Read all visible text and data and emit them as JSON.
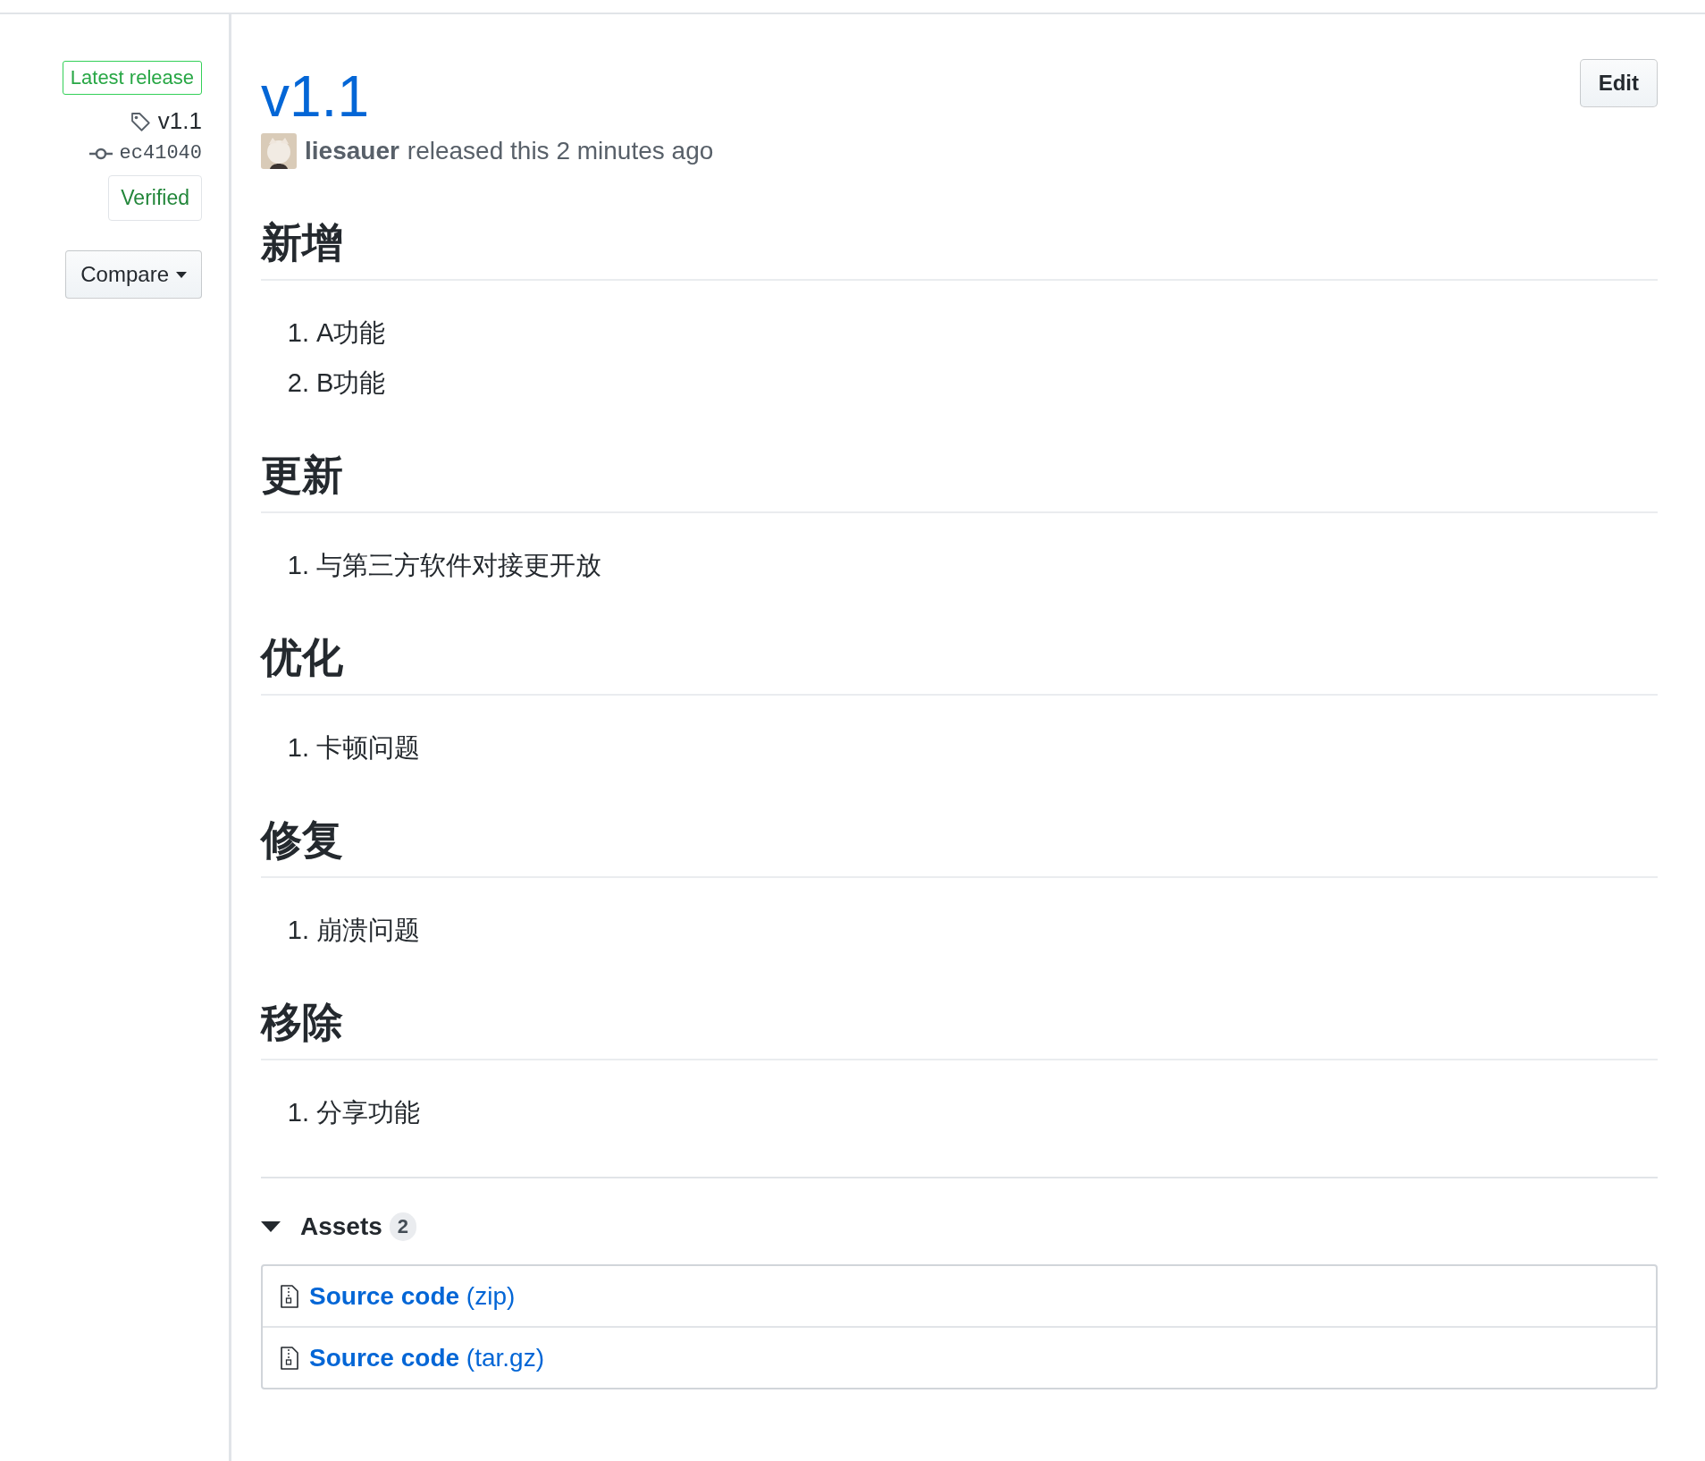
{
  "sidebar": {
    "badge": "Latest release",
    "tag": "v1.1",
    "commit": "ec41040",
    "verified": "Verified",
    "compare_button": "Compare"
  },
  "release": {
    "title": "v1.1",
    "author": "liesauer",
    "byline": "released this 2 minutes ago",
    "edit_button": "Edit"
  },
  "sections": [
    {
      "heading": "新增",
      "items": [
        {
          "number": "1.",
          "text": "A功能"
        },
        {
          "number": "2.",
          "text": "B功能"
        }
      ]
    },
    {
      "heading": "更新",
      "items": [
        {
          "number": "1.",
          "text": "与第三方软件对接更开放"
        }
      ]
    },
    {
      "heading": "优化",
      "items": [
        {
          "number": "1.",
          "text": "卡顿问题"
        }
      ]
    },
    {
      "heading": "修复",
      "items": [
        {
          "number": "1.",
          "text": "崩溃问题"
        }
      ]
    },
    {
      "heading": "移除",
      "items": [
        {
          "number": "1.",
          "text": "分享功能"
        }
      ]
    }
  ],
  "assets": {
    "title": "Assets",
    "count": "2",
    "expanded": true,
    "items": [
      {
        "name": "Source code",
        "format": "(zip)"
      },
      {
        "name": "Source code",
        "format": "(tar.gz)"
      }
    ]
  }
}
